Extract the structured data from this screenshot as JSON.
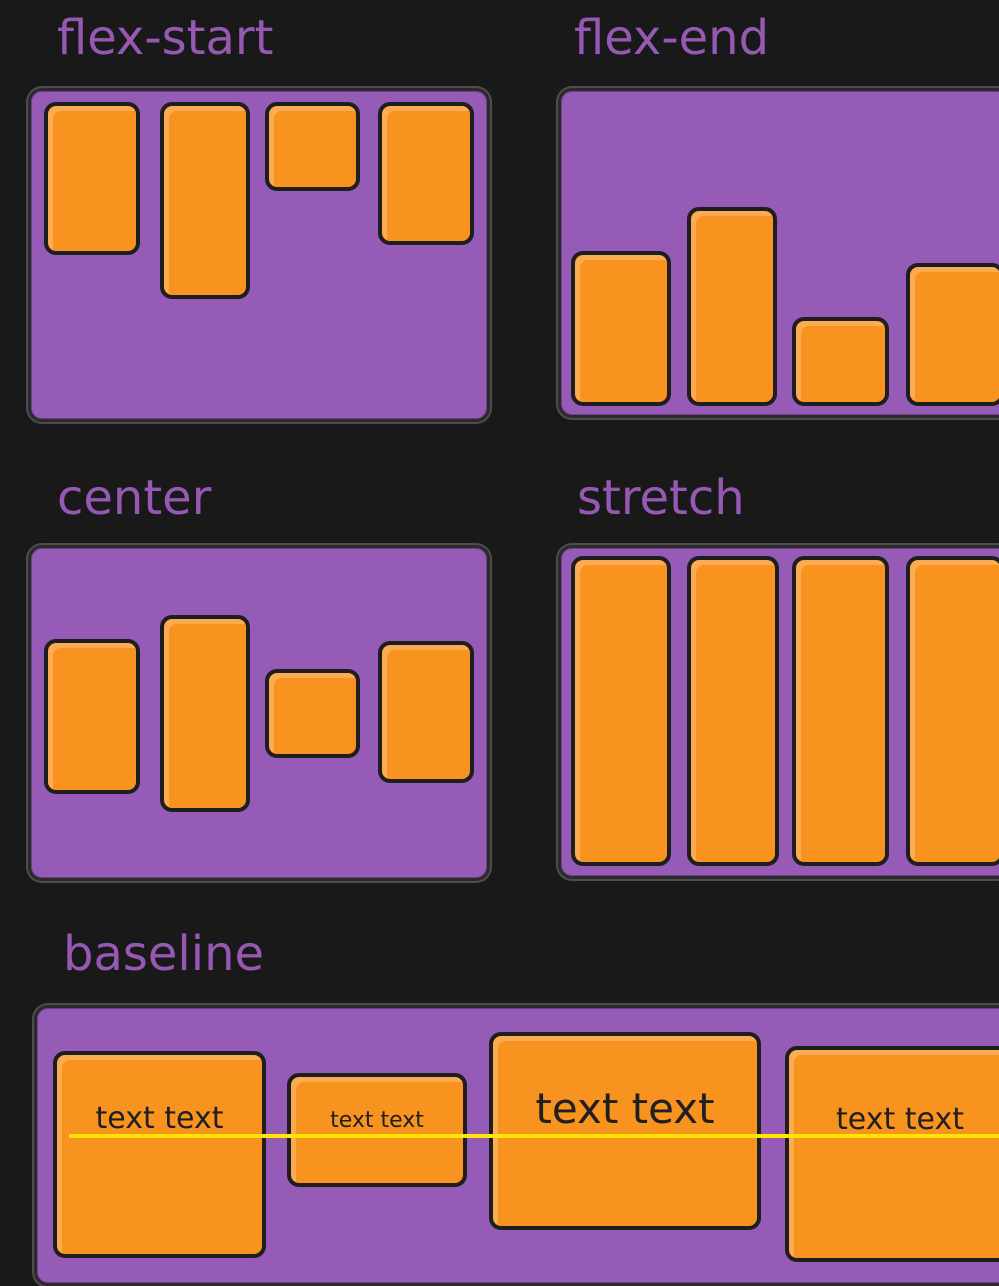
{
  "labels": {
    "flex_start": "flex-start",
    "flex_end": "flex-end",
    "center": "center",
    "stretch": "stretch",
    "baseline": "baseline"
  },
  "baseline_texts": [
    "text text",
    "text text",
    "text text",
    "text text"
  ],
  "colors": {
    "background": "#191919",
    "container": "#965bb6",
    "item": "#f7931e",
    "label": "#9659b3",
    "baseline_line": "#ffe600"
  }
}
